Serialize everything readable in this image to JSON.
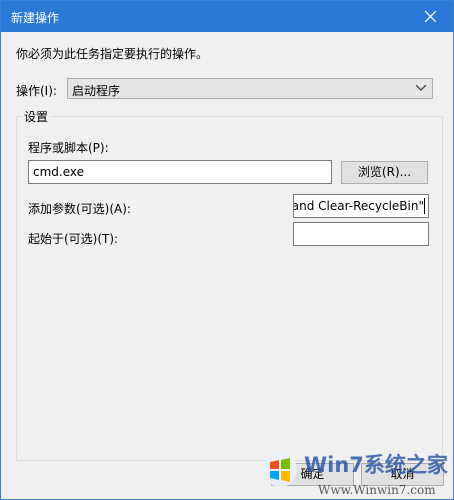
{
  "window": {
    "title": "新建操作"
  },
  "instruction": "你必须为此任务指定要执行的操作。",
  "action": {
    "label": "操作(I):",
    "value": "启动程序"
  },
  "settings": {
    "group_title": "设置",
    "program_label": "程序或脚本(P):",
    "program_value": "cmd.exe",
    "browse_label": "浏览(R)...",
    "args_label": "添加参数(可选)(A):",
    "args_value": "uand Clear-RecycleBin\"",
    "startin_label": "起始于(可选)(T):",
    "startin_value": ""
  },
  "buttons": {
    "ok": "确定",
    "cancel": "取消"
  },
  "watermark": {
    "brand": "Win7系统之家",
    "url": "Www.Winwin7.com"
  },
  "colors": {
    "titlebar": "#2b79d7",
    "window_bg": "#f0f0f0"
  }
}
